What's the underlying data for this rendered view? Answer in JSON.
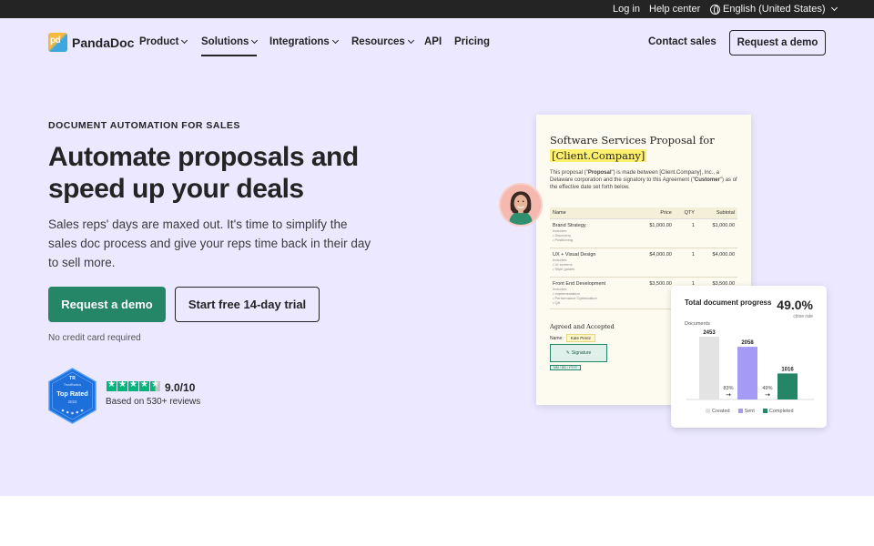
{
  "topbar": {
    "login": "Log in",
    "help": "Help center",
    "language": "English (United States)"
  },
  "nav": {
    "brand": "PandaDoc",
    "brand_mark": "pd",
    "items": [
      {
        "label": "Product",
        "dropdown": true
      },
      {
        "label": "Solutions",
        "dropdown": true,
        "active": true
      },
      {
        "label": "Integrations",
        "dropdown": true
      },
      {
        "label": "Resources",
        "dropdown": true
      },
      {
        "label": "API",
        "dropdown": false
      },
      {
        "label": "Pricing",
        "dropdown": false
      }
    ],
    "contact": "Contact sales",
    "demo": "Request a demo"
  },
  "hero": {
    "eyebrow": "DOCUMENT AUTOMATION FOR SALES",
    "headline": "Automate proposals and speed up your deals",
    "lead": "Sales reps' days are maxed out. It's time to simplify the sales doc process and give your reps time back in their day to sell more.",
    "primary_cta": "Request a demo",
    "secondary_cta": "Start free 14-day trial",
    "note": "No credit card required"
  },
  "rating": {
    "badge_brand": "TrustRadius",
    "badge_title": "Top Rated",
    "badge_year": "2024",
    "stars": 4.5,
    "score": "9.0/10",
    "reviews": "Based on 530+ reviews"
  },
  "doc": {
    "title": "Software Services Proposal for",
    "title_highlight": "[Client.Company]",
    "intro_start": "This proposal (\"",
    "intro_proposal": "Proposal",
    "intro_mid": "\") is made between [Client.Company], Inc., a Delaware corporation and the signatory to this Agreement (\"",
    "intro_customer": "Customer",
    "intro_end": "\") as of the effective date set forth below.",
    "columns": [
      "Name",
      "Price",
      "QTY",
      "Subtotal"
    ],
    "rows": [
      {
        "name": "Brand Strategy",
        "sub": [
          "Includes:",
          "• Discovery",
          "• Positioning"
        ],
        "price": "$1,000.00",
        "qty": "1",
        "subtotal": "$1,000.00"
      },
      {
        "name": "UX + Visual Design",
        "sub": [
          "Includes:",
          "• UI screens",
          "• Style guides"
        ],
        "price": "$4,000.00",
        "qty": "1",
        "subtotal": "$4,000.00"
      },
      {
        "name": "Front End Development",
        "sub": [
          "Includes:",
          "• Implementation",
          "• Performance Optimization",
          "• QA"
        ],
        "price": "$3,500.00",
        "qty": "1",
        "subtotal": "$3,500.00"
      }
    ],
    "agreed": "Agreed and Accepted",
    "name_label": "Name:",
    "name_value": "Kate Perez",
    "signature": "Signature",
    "date_placeholder": "MM / DD / YYYY"
  },
  "progress": {
    "title": "Total document progress",
    "percent": "49.0%",
    "close_rate": "close rate",
    "axis_label": "Documents",
    "bars": [
      {
        "label": "Created",
        "value": 2453,
        "color": "#e3e3e3"
      },
      {
        "label": "Sent",
        "value": 2058,
        "color": "#a59af5"
      },
      {
        "label": "Completed",
        "value": 1016,
        "color": "#248567"
      }
    ],
    "conversions": [
      "83%",
      "49%"
    ]
  },
  "colors": {
    "hero_bg": "#ebe8ff",
    "brand_green": "#248567",
    "dark": "#242424"
  },
  "icons": [
    "globe-icon",
    "chevron-down-icon",
    "star-icon",
    "pen-icon",
    "arrow-right-icon"
  ]
}
